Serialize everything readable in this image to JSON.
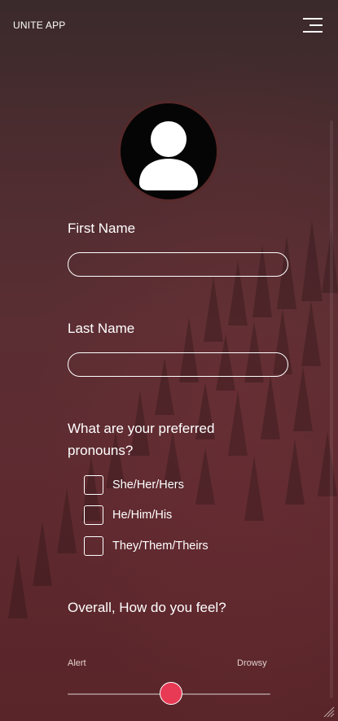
{
  "app": {
    "title": "UNITE APP"
  },
  "icons": {
    "menu": "hamburger-menu-icon",
    "avatar": "user-avatar-icon",
    "resize": "resize-grip-icon"
  },
  "form": {
    "first_name": {
      "label": "First Name",
      "value": "",
      "placeholder": ""
    },
    "last_name": {
      "label": "Last Name",
      "value": "",
      "placeholder": ""
    },
    "pronouns": {
      "question": "What are your preferred pronouns?",
      "options": [
        {
          "label": "She/Her/Hers",
          "checked": false
        },
        {
          "label": "He/Him/His",
          "checked": false
        },
        {
          "label": "They/Them/Theirs",
          "checked": false
        }
      ]
    },
    "feeling": {
      "question": "Overall, How do you feel?",
      "min_label": "Alert",
      "max_label": "Drowsy",
      "value_fraction": 0.51
    }
  },
  "colors": {
    "accent": "#e83a55",
    "background_top": "#3a2a2b",
    "background_bottom": "#5a2529"
  }
}
